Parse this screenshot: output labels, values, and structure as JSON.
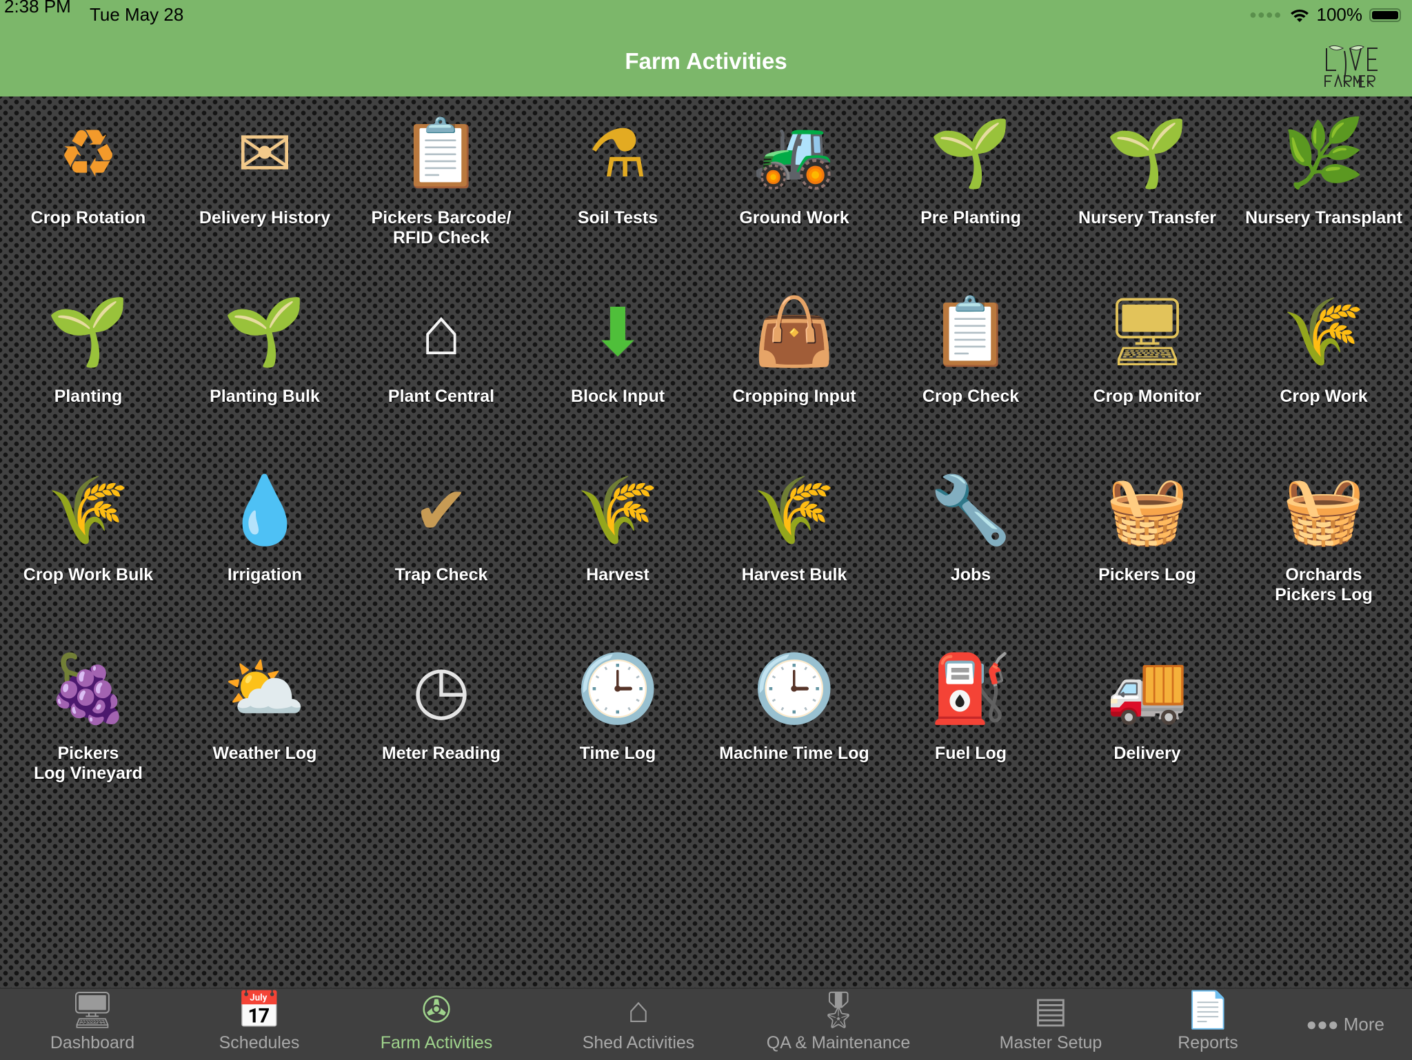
{
  "status": {
    "time": "2:38 PM",
    "date": "Tue May 28",
    "battery": "100%"
  },
  "header": {
    "title": "Farm Activities",
    "logo_text": "LIVE FARMER"
  },
  "colors": {
    "header": "#7cb76a",
    "active_tab": "#9fd38c"
  },
  "activities": [
    {
      "label": "Crop Rotation",
      "icon": "crop-rotation-icon",
      "glyph": "♻",
      "color": "#f39a2b"
    },
    {
      "label": "Delivery History",
      "icon": "envelope-report-icon",
      "glyph": "✉",
      "color": "#f2c98a"
    },
    {
      "label": "Pickers Barcode/\nRFID Check",
      "icon": "barcode-clipboard-icon",
      "glyph": "📋",
      "color": "#e9e1d2"
    },
    {
      "label": "Soil Tests",
      "icon": "flask-icon",
      "glyph": "⚗",
      "color": "#e3ab22"
    },
    {
      "label": "Ground Work",
      "icon": "tractor-icon",
      "glyph": "🚜",
      "color": "#3f9a2a"
    },
    {
      "label": "Pre Planting",
      "icon": "soil-shovel-icon",
      "glyph": "🌱",
      "color": "#6a6a6a"
    },
    {
      "label": "Nursery Transfer",
      "icon": "nursery-transfer-icon",
      "glyph": "🌱",
      "color": "#8ec27a"
    },
    {
      "label": "Nursery Transplant",
      "icon": "nursery-transplant-icon",
      "glyph": "🌿",
      "color": "#8ec27a"
    },
    {
      "label": "Planting",
      "icon": "seedling-icon",
      "glyph": "🌱",
      "color": "#5b9d2e"
    },
    {
      "label": "Planting Bulk",
      "icon": "seedling-plus-icon",
      "glyph": "🌱",
      "color": "#5b9d2e"
    },
    {
      "label": "Plant Central",
      "icon": "green-house-icon",
      "glyph": "⌂",
      "color": "#f5f5f5"
    },
    {
      "label": "Block Input",
      "icon": "field-download-icon",
      "glyph": "⬇",
      "color": "#4fbf3a"
    },
    {
      "label": "Cropping Input",
      "icon": "fertilizer-sack-icon",
      "glyph": "👜",
      "color": "#8a6a44"
    },
    {
      "label": "Crop Check",
      "icon": "crop-check-icon",
      "glyph": "📋",
      "color": "#e2c35a"
    },
    {
      "label": "Crop Monitor",
      "icon": "crop-monitor-icon",
      "glyph": "🖥",
      "color": "#e2c35a"
    },
    {
      "label": "Crop Work",
      "icon": "crop-work-icon",
      "glyph": "🌾",
      "color": "#e8c12d"
    },
    {
      "label": "Crop Work Bulk",
      "icon": "crop-work-bulk-icon",
      "glyph": "🌾",
      "color": "#e8c12d"
    },
    {
      "label": "Irrigation",
      "icon": "water-drops-leaf-icon",
      "glyph": "💧",
      "color": "#8fc9e8"
    },
    {
      "label": "Trap Check",
      "icon": "mouse-trap-icon",
      "glyph": "✔",
      "color": "#c79b55"
    },
    {
      "label": "Harvest",
      "icon": "wheat-scythe-icon",
      "glyph": "🌾",
      "color": "#e0b52b"
    },
    {
      "label": "Harvest Bulk",
      "icon": "sales-wheat-icon",
      "glyph": "🌾",
      "color": "#f08a4b"
    },
    {
      "label": "Jobs",
      "icon": "worker-wrench-icon",
      "glyph": "🔧",
      "color": "#4a8fd4"
    },
    {
      "label": "Pickers Log",
      "icon": "basket-icon",
      "glyph": "🧺",
      "color": "#c49250"
    },
    {
      "label": "Orchards\nPickers Log",
      "icon": "fruit-basket-icon",
      "glyph": "🧺",
      "color": "#c49250"
    },
    {
      "label": "Pickers\nLog Vineyard",
      "icon": "grape-basket-icon",
      "glyph": "🍇",
      "color": "#7a3b9a"
    },
    {
      "label": "Weather Log",
      "icon": "weather-globe-icon",
      "glyph": "⛅",
      "color": "#2f62b3"
    },
    {
      "label": "Meter Reading",
      "icon": "meter-gauge-icon",
      "glyph": "◷",
      "color": "#e5e5e5"
    },
    {
      "label": "Time Log",
      "icon": "clock-key-icon",
      "glyph": "🕒",
      "color": "#f0f0f0"
    },
    {
      "label": "Machine Time Log",
      "icon": "clock-tractor-icon",
      "glyph": "🕒",
      "color": "#7fd06a"
    },
    {
      "label": "Fuel Log",
      "icon": "fuel-pump-icon",
      "glyph": "⛽",
      "color": "#3aa83a"
    },
    {
      "label": "Delivery",
      "icon": "truck-icon",
      "glyph": "🚚",
      "color": "#6b4a2a"
    }
  ],
  "tabs": [
    {
      "label": "Dashboard",
      "icon": "monitor-icon",
      "glyph": "🖥"
    },
    {
      "label": "Schedules",
      "icon": "calendar-clock-icon",
      "glyph": "📅"
    },
    {
      "label": "Farm Activities",
      "icon": "windmill-icon",
      "glyph": "✇",
      "active": true
    },
    {
      "label": "Shed Activities",
      "icon": "shed-icon",
      "glyph": "⌂"
    },
    {
      "label": "QA & Maintenance",
      "icon": "medal-icon",
      "glyph": "🎖"
    },
    {
      "label": "Master Setup",
      "icon": "setup-form-icon",
      "glyph": "▤"
    },
    {
      "label": "Reports",
      "icon": "report-document-icon",
      "glyph": "📄"
    }
  ],
  "more_label": "More"
}
